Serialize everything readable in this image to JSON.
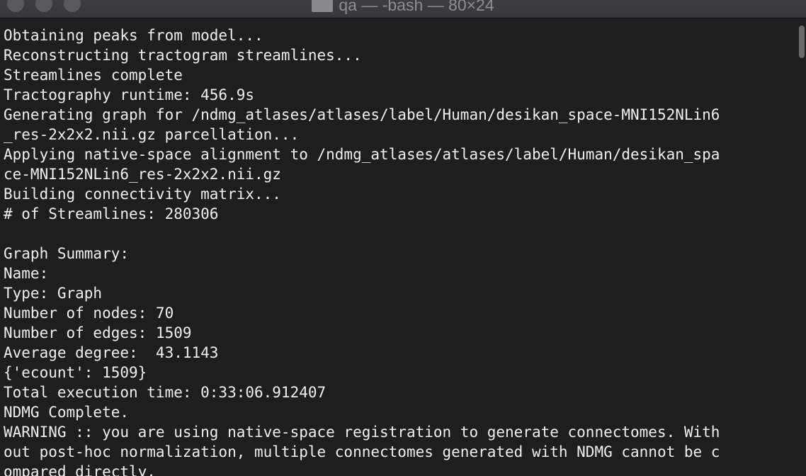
{
  "window": {
    "title": "qa — -bash — 80×24"
  },
  "terminal": {
    "lines": [
      "Obtaining peaks from model...",
      "Reconstructing tractogram streamlines...",
      "Streamlines complete",
      "Tractography runtime: 456.9s",
      "Generating graph for /ndmg_atlases/atlases/label/Human/desikan_space-MNI152NLin6",
      "_res-2x2x2.nii.gz parcellation...",
      "Applying native-space alignment to /ndmg_atlases/atlases/label/Human/desikan_spa",
      "ce-MNI152NLin6_res-2x2x2.nii.gz",
      "Building connectivity matrix...",
      "# of Streamlines: 280306",
      "",
      "Graph Summary:",
      "Name:",
      "Type: Graph",
      "Number of nodes: 70",
      "Number of edges: 1509",
      "Average degree:  43.1143",
      "{'ecount': 1509}",
      "Total execution time: 0:33:06.912407",
      "NDMG Complete.",
      "WARNING :: you are using native-space registration to generate connectomes. With",
      "out post-hoc normalization, multiple connectomes generated with NDMG cannot be c",
      "ompared directly."
    ]
  }
}
